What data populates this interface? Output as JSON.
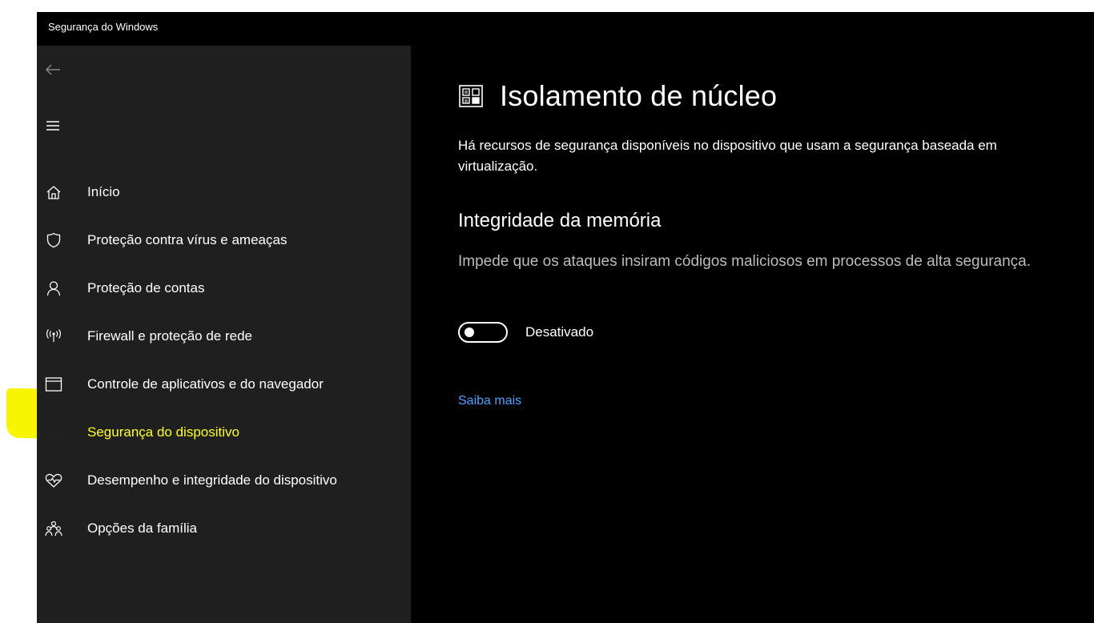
{
  "window": {
    "title": "Segurança do Windows"
  },
  "sidebar": {
    "back_icon": "back-arrow-icon",
    "menu_icon": "hamburger-menu-icon",
    "items": [
      {
        "label": "Início",
        "icon": "home-icon"
      },
      {
        "label": "Proteção contra vírus e ameaças",
        "icon": "shield-icon"
      },
      {
        "label": "Proteção de contas",
        "icon": "person-icon"
      },
      {
        "label": "Firewall e proteção de rede",
        "icon": "wireless-antenna-icon"
      },
      {
        "label": "Controle de aplicativos e do navegador",
        "icon": "app-window-icon"
      },
      {
        "label": "Segurança do dispositivo",
        "icon": "laptop-icon",
        "selected": true
      },
      {
        "label": "Desempenho e integridade do dispositivo",
        "icon": "heart-pulse-icon"
      },
      {
        "label": "Opções da família",
        "icon": "family-icon"
      }
    ],
    "highlight_color": "#f7f500"
  },
  "main": {
    "header_icon": "core-isolation-chip-icon",
    "title": "Isolamento de núcleo",
    "description": "Há recursos de segurança disponíveis no dispositivo que usam a segurança baseada em virtualização.",
    "memory_integrity": {
      "title": "Integridade da memória",
      "description": "Impede que os ataques insiram códigos maliciosos em processos de alta segurança.",
      "toggle_state": "off",
      "toggle_label": "Desativado"
    },
    "learn_more": "Saiba mais"
  },
  "colors": {
    "sidebar_bg": "#1f1f1f",
    "main_bg": "#000000",
    "link": "#4aa3ff",
    "selected_text": "#ffff1a"
  }
}
